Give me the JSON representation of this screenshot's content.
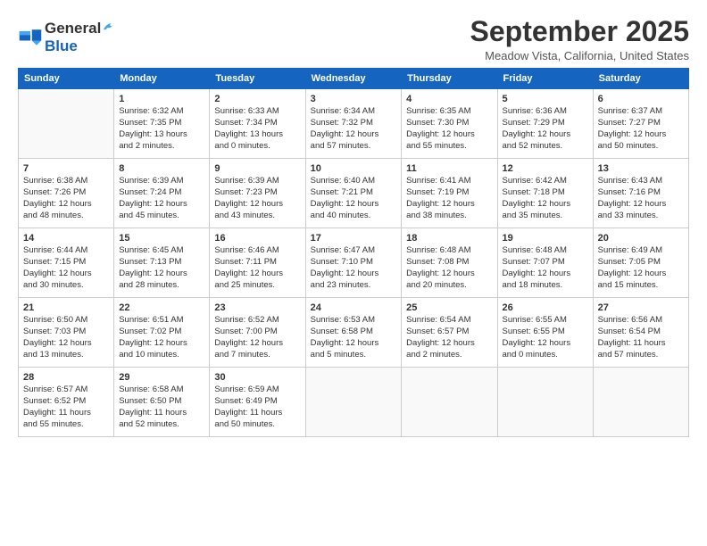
{
  "logo": {
    "line1": "General",
    "line2": "Blue"
  },
  "title": "September 2025",
  "location": "Meadow Vista, California, United States",
  "weekdays": [
    "Sunday",
    "Monday",
    "Tuesday",
    "Wednesday",
    "Thursday",
    "Friday",
    "Saturday"
  ],
  "weeks": [
    [
      {
        "day": "",
        "info": ""
      },
      {
        "day": "1",
        "info": "Sunrise: 6:32 AM\nSunset: 7:35 PM\nDaylight: 13 hours\nand 2 minutes."
      },
      {
        "day": "2",
        "info": "Sunrise: 6:33 AM\nSunset: 7:34 PM\nDaylight: 13 hours\nand 0 minutes."
      },
      {
        "day": "3",
        "info": "Sunrise: 6:34 AM\nSunset: 7:32 PM\nDaylight: 12 hours\nand 57 minutes."
      },
      {
        "day": "4",
        "info": "Sunrise: 6:35 AM\nSunset: 7:30 PM\nDaylight: 12 hours\nand 55 minutes."
      },
      {
        "day": "5",
        "info": "Sunrise: 6:36 AM\nSunset: 7:29 PM\nDaylight: 12 hours\nand 52 minutes."
      },
      {
        "day": "6",
        "info": "Sunrise: 6:37 AM\nSunset: 7:27 PM\nDaylight: 12 hours\nand 50 minutes."
      }
    ],
    [
      {
        "day": "7",
        "info": "Sunrise: 6:38 AM\nSunset: 7:26 PM\nDaylight: 12 hours\nand 48 minutes."
      },
      {
        "day": "8",
        "info": "Sunrise: 6:39 AM\nSunset: 7:24 PM\nDaylight: 12 hours\nand 45 minutes."
      },
      {
        "day": "9",
        "info": "Sunrise: 6:39 AM\nSunset: 7:23 PM\nDaylight: 12 hours\nand 43 minutes."
      },
      {
        "day": "10",
        "info": "Sunrise: 6:40 AM\nSunset: 7:21 PM\nDaylight: 12 hours\nand 40 minutes."
      },
      {
        "day": "11",
        "info": "Sunrise: 6:41 AM\nSunset: 7:19 PM\nDaylight: 12 hours\nand 38 minutes."
      },
      {
        "day": "12",
        "info": "Sunrise: 6:42 AM\nSunset: 7:18 PM\nDaylight: 12 hours\nand 35 minutes."
      },
      {
        "day": "13",
        "info": "Sunrise: 6:43 AM\nSunset: 7:16 PM\nDaylight: 12 hours\nand 33 minutes."
      }
    ],
    [
      {
        "day": "14",
        "info": "Sunrise: 6:44 AM\nSunset: 7:15 PM\nDaylight: 12 hours\nand 30 minutes."
      },
      {
        "day": "15",
        "info": "Sunrise: 6:45 AM\nSunset: 7:13 PM\nDaylight: 12 hours\nand 28 minutes."
      },
      {
        "day": "16",
        "info": "Sunrise: 6:46 AM\nSunset: 7:11 PM\nDaylight: 12 hours\nand 25 minutes."
      },
      {
        "day": "17",
        "info": "Sunrise: 6:47 AM\nSunset: 7:10 PM\nDaylight: 12 hours\nand 23 minutes."
      },
      {
        "day": "18",
        "info": "Sunrise: 6:48 AM\nSunset: 7:08 PM\nDaylight: 12 hours\nand 20 minutes."
      },
      {
        "day": "19",
        "info": "Sunrise: 6:48 AM\nSunset: 7:07 PM\nDaylight: 12 hours\nand 18 minutes."
      },
      {
        "day": "20",
        "info": "Sunrise: 6:49 AM\nSunset: 7:05 PM\nDaylight: 12 hours\nand 15 minutes."
      }
    ],
    [
      {
        "day": "21",
        "info": "Sunrise: 6:50 AM\nSunset: 7:03 PM\nDaylight: 12 hours\nand 13 minutes."
      },
      {
        "day": "22",
        "info": "Sunrise: 6:51 AM\nSunset: 7:02 PM\nDaylight: 12 hours\nand 10 minutes."
      },
      {
        "day": "23",
        "info": "Sunrise: 6:52 AM\nSunset: 7:00 PM\nDaylight: 12 hours\nand 7 minutes."
      },
      {
        "day": "24",
        "info": "Sunrise: 6:53 AM\nSunset: 6:58 PM\nDaylight: 12 hours\nand 5 minutes."
      },
      {
        "day": "25",
        "info": "Sunrise: 6:54 AM\nSunset: 6:57 PM\nDaylight: 12 hours\nand 2 minutes."
      },
      {
        "day": "26",
        "info": "Sunrise: 6:55 AM\nSunset: 6:55 PM\nDaylight: 12 hours\nand 0 minutes."
      },
      {
        "day": "27",
        "info": "Sunrise: 6:56 AM\nSunset: 6:54 PM\nDaylight: 11 hours\nand 57 minutes."
      }
    ],
    [
      {
        "day": "28",
        "info": "Sunrise: 6:57 AM\nSunset: 6:52 PM\nDaylight: 11 hours\nand 55 minutes."
      },
      {
        "day": "29",
        "info": "Sunrise: 6:58 AM\nSunset: 6:50 PM\nDaylight: 11 hours\nand 52 minutes."
      },
      {
        "day": "30",
        "info": "Sunrise: 6:59 AM\nSunset: 6:49 PM\nDaylight: 11 hours\nand 50 minutes."
      },
      {
        "day": "",
        "info": ""
      },
      {
        "day": "",
        "info": ""
      },
      {
        "day": "",
        "info": ""
      },
      {
        "day": "",
        "info": ""
      }
    ]
  ]
}
